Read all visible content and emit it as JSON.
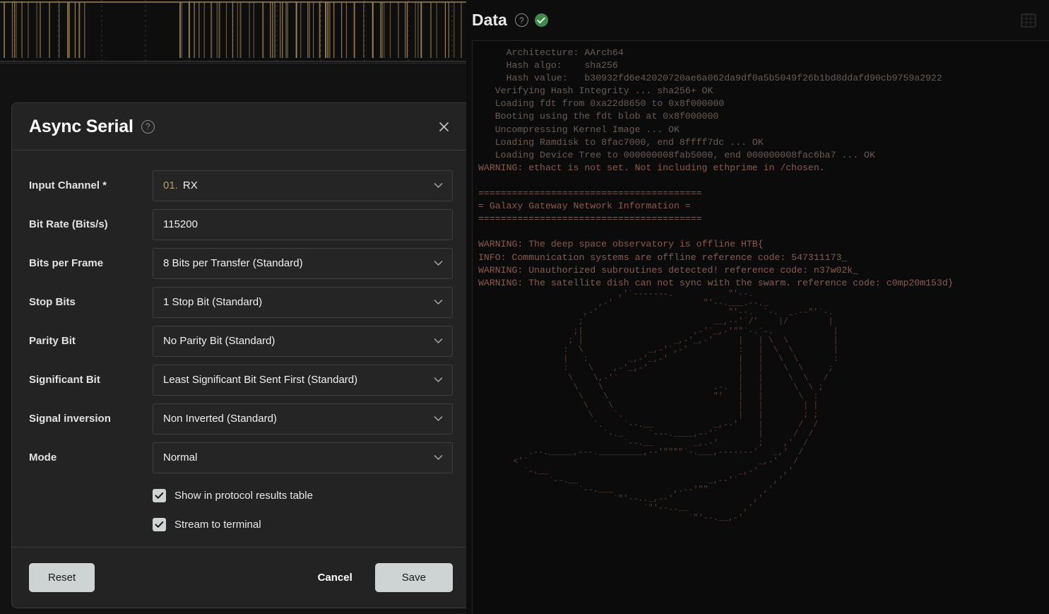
{
  "dialog": {
    "title": "Async Serial",
    "help_icon": "help-circle-icon",
    "close_icon": "close-icon",
    "fields": [
      {
        "label": "Input Channel *",
        "type": "select",
        "prefix": "01.",
        "value": "RX"
      },
      {
        "label": "Bit Rate (Bits/s)",
        "type": "text",
        "value": "115200",
        "placeholder": ""
      },
      {
        "label": "Bits per Frame",
        "type": "select",
        "value": "8 Bits per Transfer (Standard)"
      },
      {
        "label": "Stop Bits",
        "type": "select",
        "value": "1 Stop Bit (Standard)"
      },
      {
        "label": "Parity Bit",
        "type": "select",
        "value": "No Parity Bit (Standard)"
      },
      {
        "label": "Significant Bit",
        "type": "select",
        "value": "Least Significant Bit Sent First (Standard)"
      },
      {
        "label": "Signal inversion",
        "type": "select",
        "value": "Non Inverted (Standard)"
      },
      {
        "label": "Mode",
        "type": "select",
        "value": "Normal"
      }
    ],
    "checkboxes": [
      {
        "label": "Show in protocol results table",
        "checked": true
      },
      {
        "label": "Stream to terminal",
        "checked": true
      }
    ],
    "buttons": {
      "reset": "Reset",
      "cancel": "Cancel",
      "save": "Save"
    }
  },
  "data_panel": {
    "title": "Data",
    "help_icon": "help-circle-icon",
    "status_icon": "check-circle-icon",
    "grid_icon": "grid-table-icon",
    "terminal": {
      "boot_log": "     Architecture: AArch64\n     Hash algo:    sha256\n     Hash value:   b30932fd6e42020720ae6a062da9df0a5b5049f26b1bd8ddafd90cb9759a2922\n   Verifying Hash Integrity ... sha256+ OK\n   Loading fdt from 0xa22d8650 to 0x8f000000\n   Booting using the fdt blob at 0x8f000000\n   Uncompressing Kernel Image ... OK\n   Loading Ramdisk to 8fac7000, end 8ffff7dc ... OK\n   Loading Device Tree to 000000008fab5000, end 000000008fac6ba7 ... OK",
      "warnings": "WARNING: ethact is not set. Not including ethprime in /chosen.\n\n========================================\n= Galaxy Gateway Network Information =\n========================================\n\nWARNING: The deep space observatory is offline HTB{\nINFO: Communication systems are offline reference code: 547311173_\nWARNING: Unauthorized subroutines detected! reference code: n37w02k_\nWARNING: The satellite dish can not sync with the swarm. reference code: c0mp20m153d}",
      "ascii_art": "                            ,'`-------.           \"'--.\n                        ,-'                  \"'--.___.--._\n                     ,-'                          \"'--.  `-.  _.--\"'`-.\n                    ;                          __,--'`/'    |/        |\n                   ;|                      ,-'`_,-'\"\"`-.`-.            |\n                  ; |                  _,-'_,-'     |   | \\  \\         |\n                 :  \\             _,-'`,-'          :   |  \\  \\        |\n                 |   :        _,-'_,-'              |   |   \\  \\       :\n                 :    \\    ,-'_,-'                  |   |    \\  \\     ;\n                  \\    \\,-'`                        |   |     \\  \\   /\n                   \\    \\                      .-.  |   |      \\  \\ ;\n                    \\    \\                     \"'   |   |       \\  :\n                     \\    \\                         |   |        | |\n                      \\    `.                       |   |        ; ;\n                       `.    `--.__            _,--'    |       /  /\n                         `-._     `---.____,--'`        |      /  /\n                             `--.__        _,.-'        ;    ,'  /\n          .--._____,---._________,--'\"\"\"\"`-.___,-------'   _,'  /\n       <'`                                              _,-'   /\n         `-.__                                      _,-'     ,'\n              `--.__                          _,--'`       ,'\n                    `--.___            ,.--'\"\"           ,'\n                           `\"'--.._,--'                ,'\n                                 `\"'--..__           ,'\n                                          `\"'--.__,-'"
    }
  },
  "waveform": {
    "name": "digital-signal-waveform",
    "trace_color": "#a08357",
    "grid_color": "#3a3a3a"
  }
}
